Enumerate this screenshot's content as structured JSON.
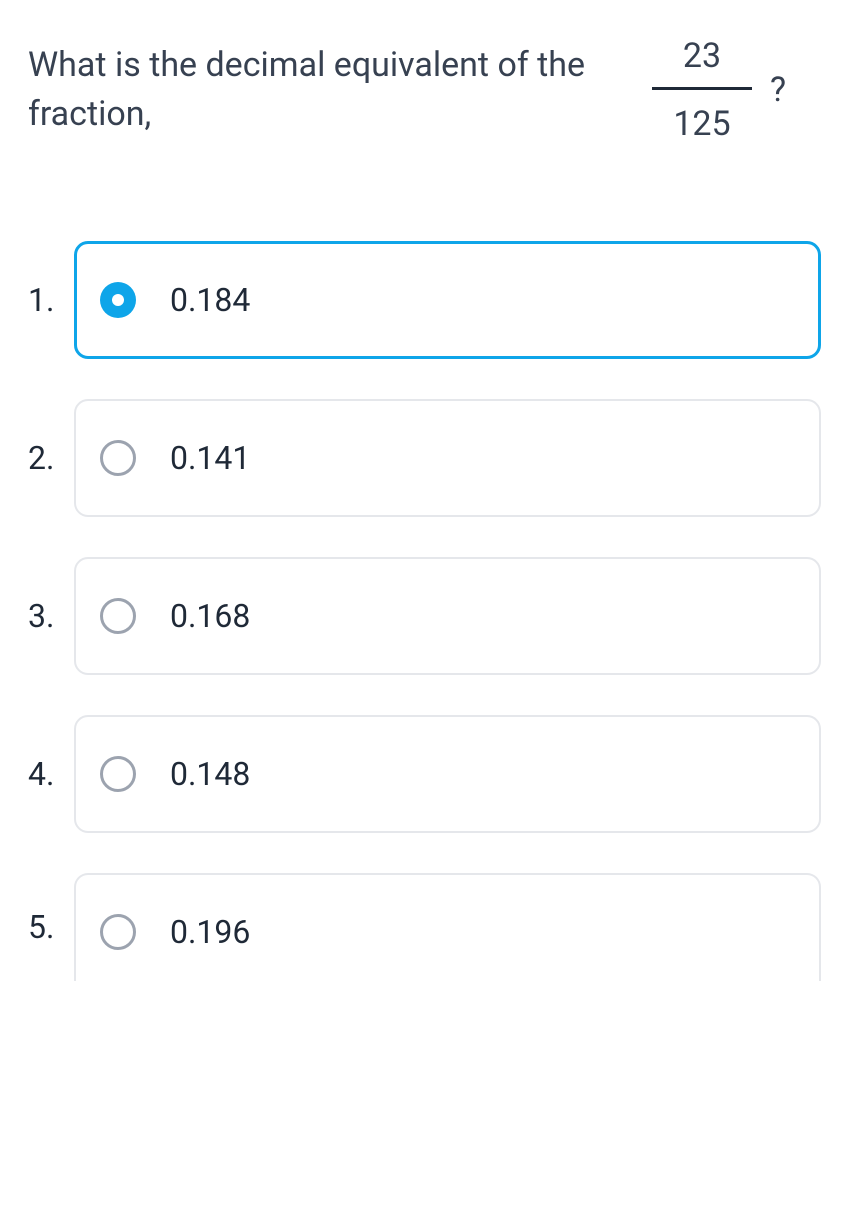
{
  "question": {
    "text": "What is the decimal equivalent of the fraction,",
    "fraction": {
      "numerator": "23",
      "denominator": "125"
    },
    "suffix": "?"
  },
  "options": [
    {
      "num": "1.",
      "label": "0.184",
      "selected": true
    },
    {
      "num": "2.",
      "label": "0.141",
      "selected": false
    },
    {
      "num": "3.",
      "label": "0.168",
      "selected": false
    },
    {
      "num": "4.",
      "label": "0.148",
      "selected": false
    },
    {
      "num": "5.",
      "label": "0.196",
      "selected": false
    }
  ]
}
